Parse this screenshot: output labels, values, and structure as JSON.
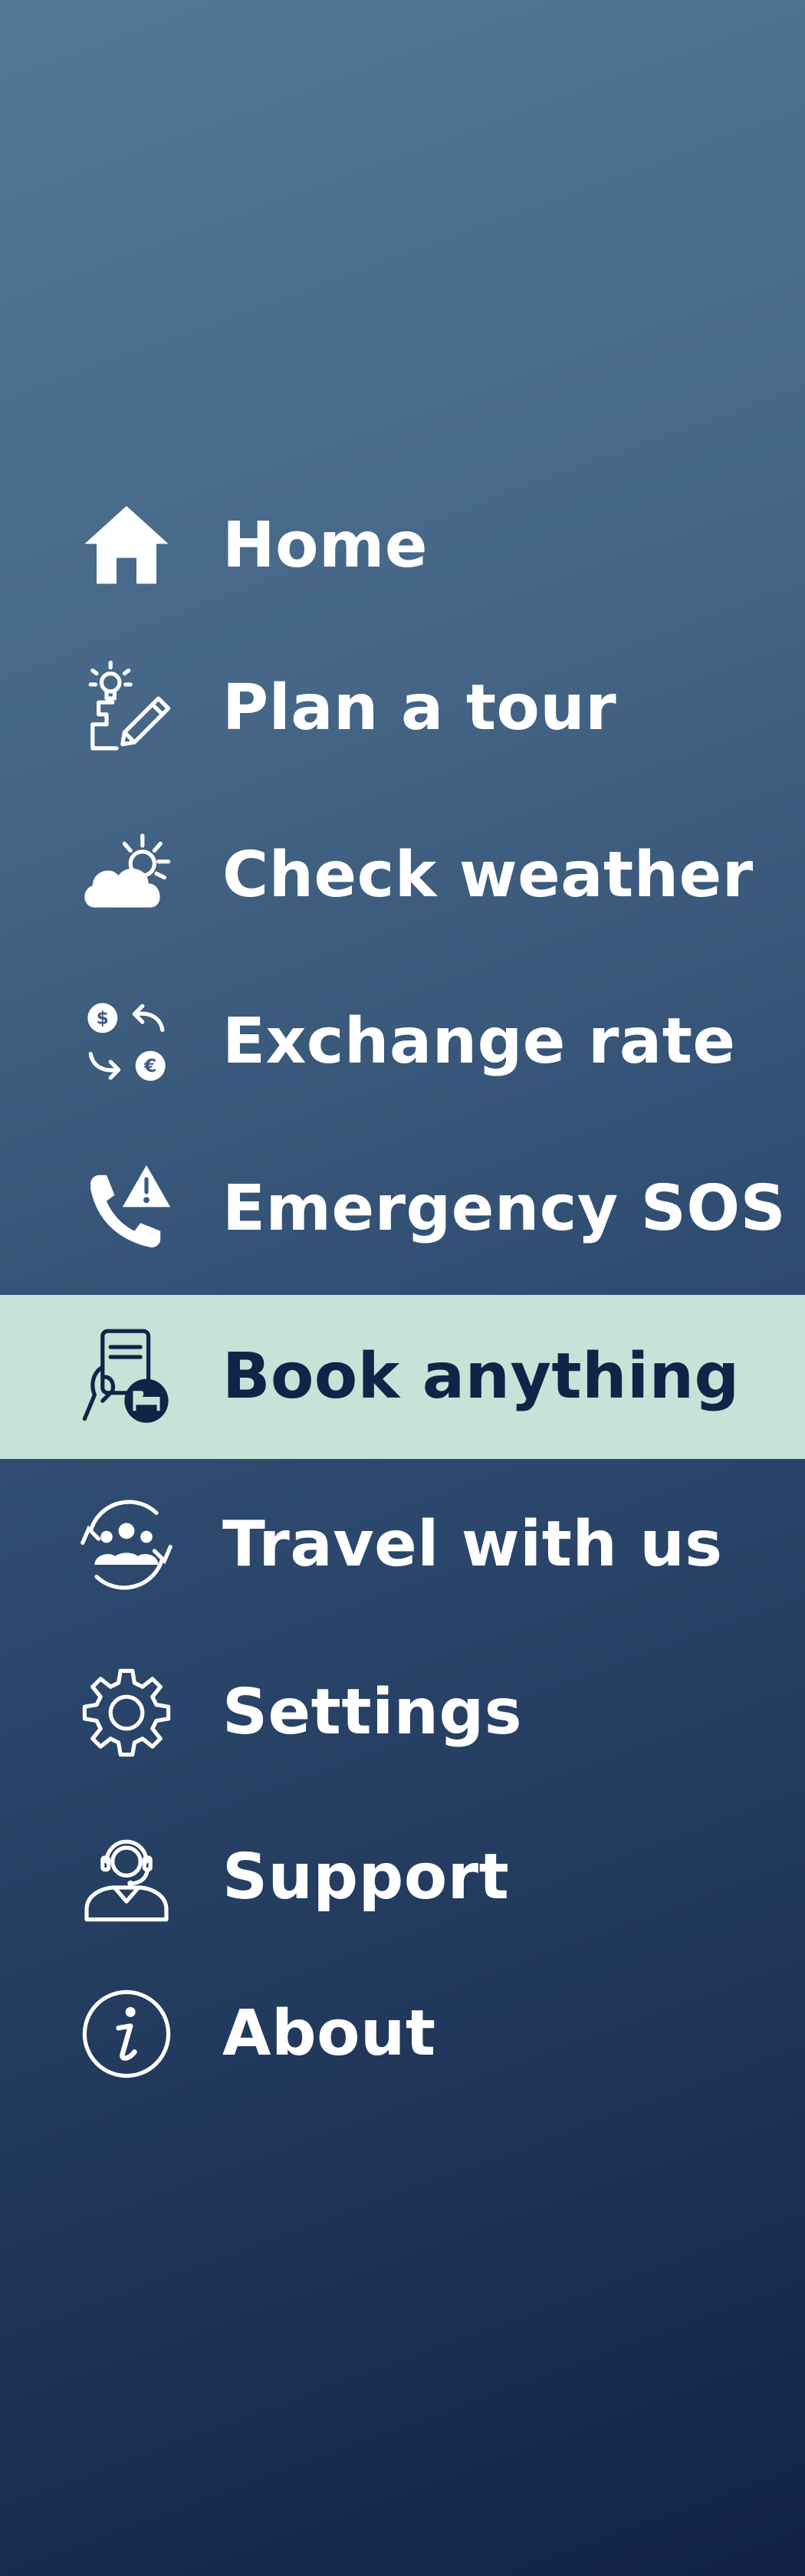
{
  "theme": {
    "active_background": "#c5e3d7",
    "active_text": "#0f2547",
    "text": "#ffffff",
    "gradient_top": "#537796",
    "gradient_bottom": "#112245"
  },
  "menu": {
    "active_index": 5,
    "items": [
      {
        "label": "Home",
        "icon": "home-icon"
      },
      {
        "label": "Plan a tour",
        "icon": "plan-tour-icon"
      },
      {
        "label": "Check weather",
        "icon": "weather-icon"
      },
      {
        "label": "Exchange rate",
        "icon": "exchange-rate-icon"
      },
      {
        "label": "Emergency SOS",
        "icon": "emergency-sos-icon"
      },
      {
        "label": "Book anything",
        "icon": "booking-icon"
      },
      {
        "label": "Travel with us",
        "icon": "group-travel-icon"
      },
      {
        "label": "Settings",
        "icon": "gear-icon"
      },
      {
        "label": "Support",
        "icon": "support-agent-icon"
      },
      {
        "label": "About",
        "icon": "info-icon"
      }
    ]
  }
}
